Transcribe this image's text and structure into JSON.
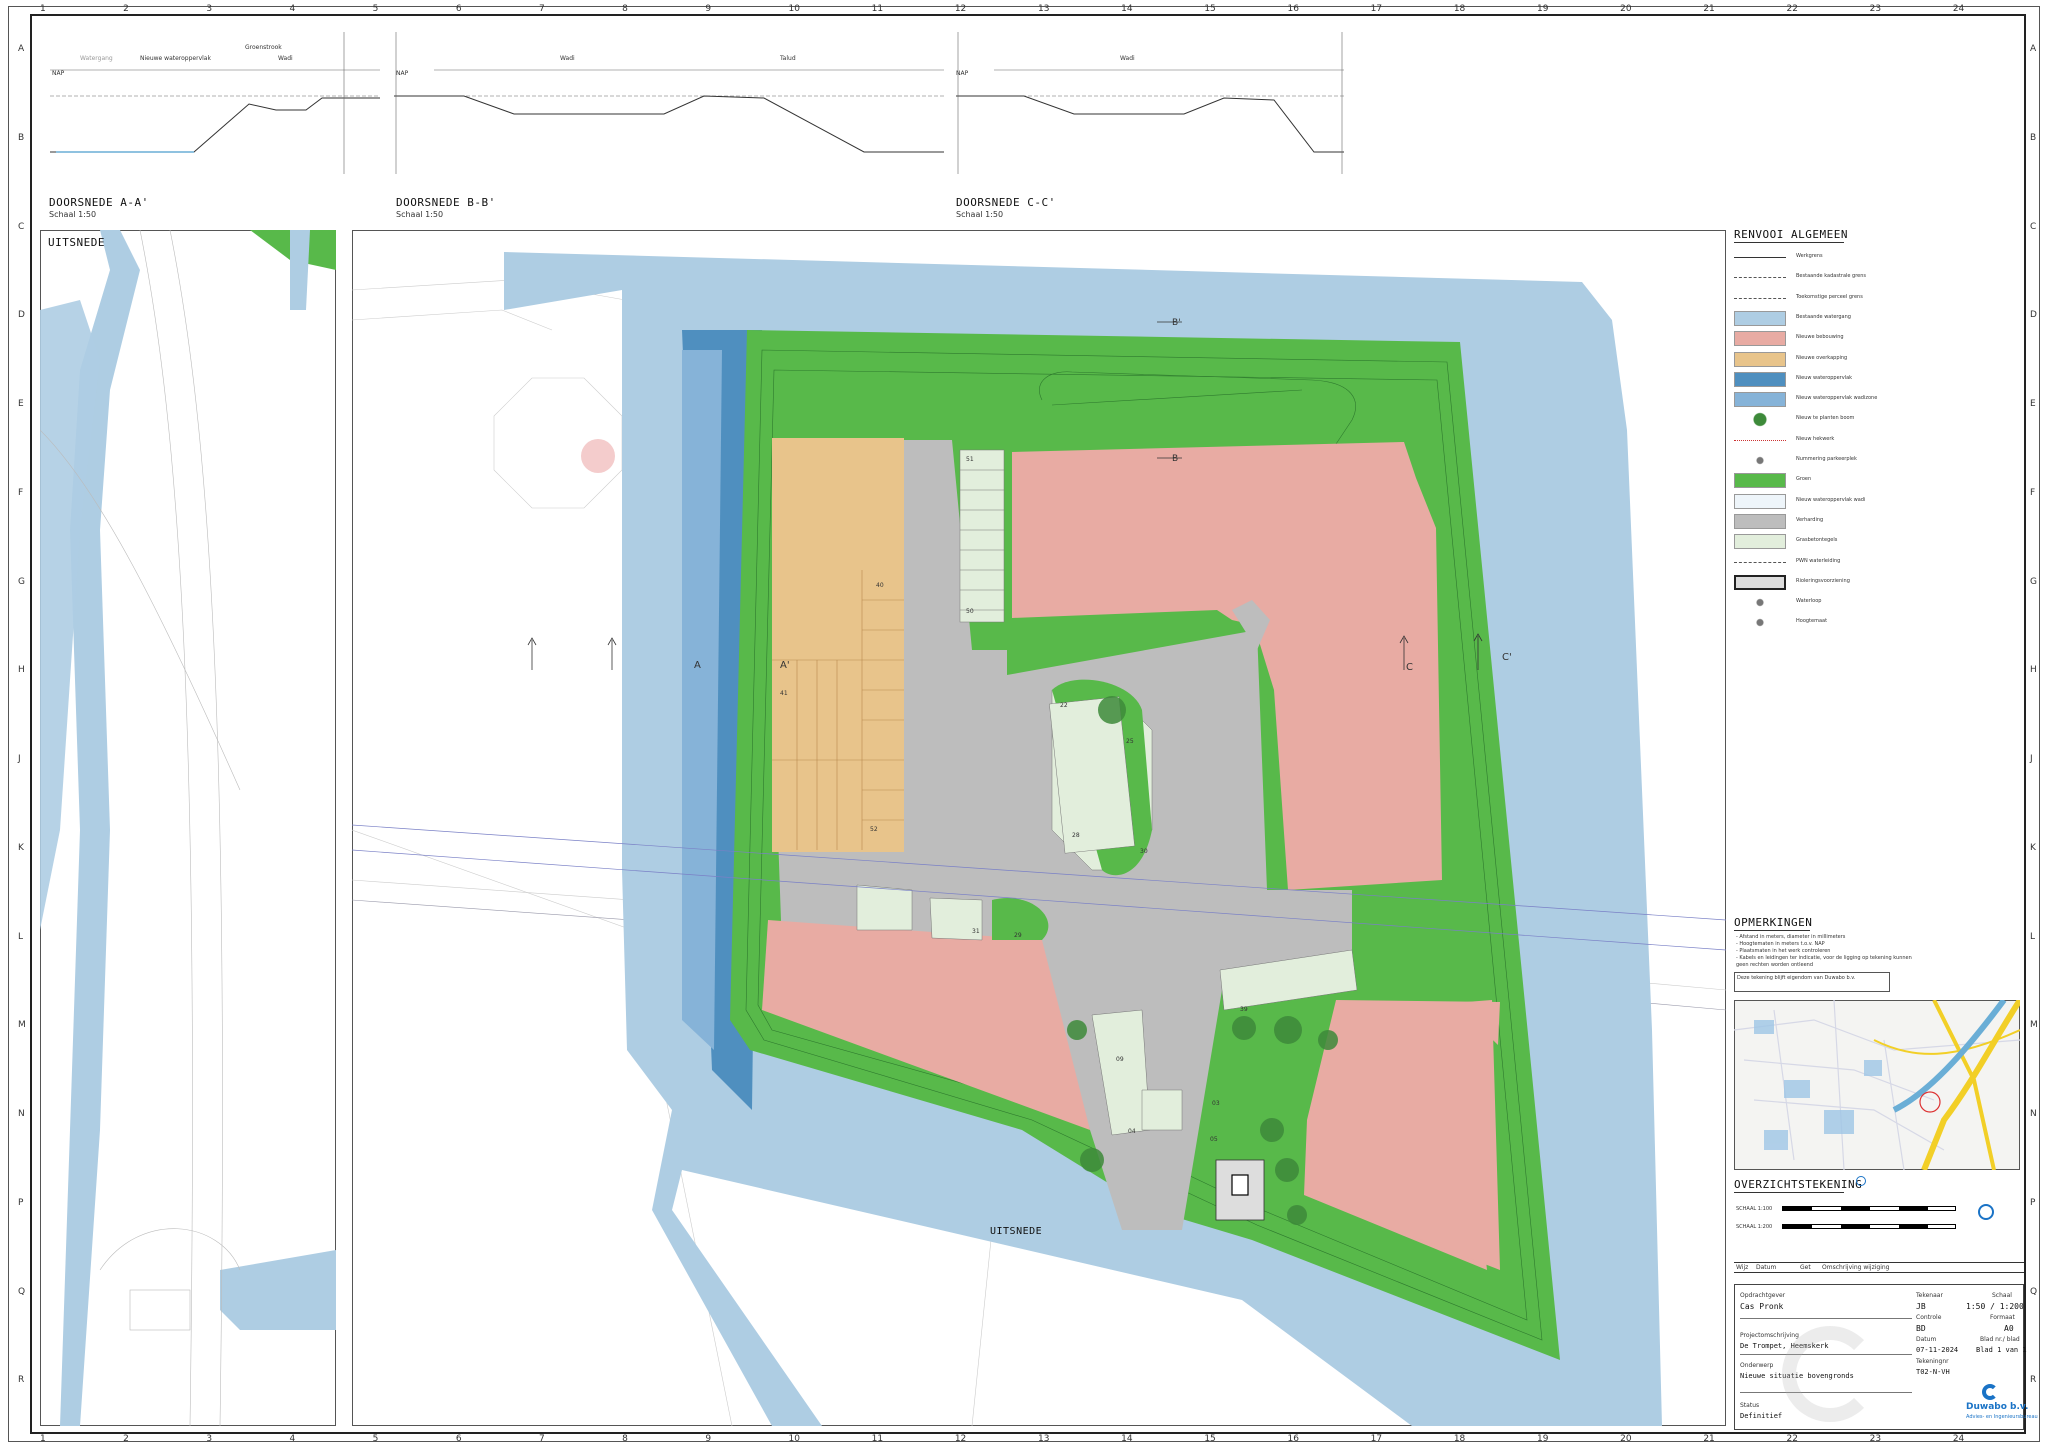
{
  "sections": {
    "a": {
      "title": "DOORSNEDE A-A'",
      "scale": "Schaal 1:50"
    },
    "b": {
      "title": "DOORSNEDE B-B'",
      "scale": "Schaal 1:50"
    },
    "c": {
      "title": "DOORSNEDE C-C'",
      "scale": "Schaal 1:50"
    }
  },
  "section_text": {
    "nap": "NAP",
    "watergang": "Watergang",
    "nieuwe_wateropp": "Nieuwe wateroppervlak",
    "talud": "Talud",
    "groenstrook": "Groenstrook",
    "wadi": "Wadi"
  },
  "uitsnede": "UITSNEDE",
  "plan_labels": {
    "a": "A",
    "a_prime": "A'",
    "b_top": "B'",
    "b_mid": "B",
    "c": "C",
    "c_prime": "C'",
    "uitsnede_bottom": "UITSNEDE"
  },
  "parking_numbers": [
    "51",
    "50",
    "40",
    "41",
    "52",
    "22",
    "25",
    "28",
    "30",
    "31",
    "29",
    "39",
    "09",
    "04",
    "03",
    "05"
  ],
  "legend": {
    "title": "RENVOOI ALGEMEEN",
    "items": [
      {
        "label": "Werkgrens",
        "kind": "line"
      },
      {
        "label": "Bestaande kadastrale grens",
        "kind": "dash"
      },
      {
        "label": "Toekomstige perceel grens",
        "kind": "dash"
      },
      {
        "label": "Bestaande watergang",
        "kind": "fill",
        "color": "#aecde3"
      },
      {
        "label": "Nieuwe bebouwing",
        "kind": "fill",
        "color": "#e8aba3"
      },
      {
        "label": "Nieuwe overkapping",
        "kind": "fill",
        "color": "#e8c48b"
      },
      {
        "label": "Nieuw wateroppervlak",
        "kind": "fill",
        "color": "#4f8fbf"
      },
      {
        "label": "Nieuw wateroppervlak wadizone",
        "kind": "fill",
        "color": "#86b3d8"
      },
      {
        "label": "Nieuw te planten boom",
        "kind": "tree"
      },
      {
        "label": "Nieuw hekwerk",
        "kind": "fence"
      },
      {
        "label": "Nummering parkeerplek",
        "kind": "num"
      },
      {
        "label": "Groen",
        "kind": "fill",
        "color": "#58b94a"
      },
      {
        "label": "Nieuw wateroppervlak wadi",
        "kind": "fill",
        "color": "#eef5fa"
      },
      {
        "label": "Verharding",
        "kind": "fill",
        "color": "#bdbdbd"
      },
      {
        "label": "Grasbetontegels",
        "kind": "fill",
        "color": "#e2eedc"
      },
      {
        "label": "PWN waterleiding",
        "kind": "dash"
      },
      {
        "label": "Rioleringsvoorziening",
        "kind": "box"
      },
      {
        "label": "Waterloop",
        "kind": "tri"
      },
      {
        "label": "Hoogtemaat",
        "kind": "dot"
      }
    ]
  },
  "remarks": {
    "title": "OPMERKINGEN",
    "lines": [
      "- Afstand in meters, diameter in millimeters",
      "- Hoogtematen in meters t.o.v. NAP",
      "- Plaatsmaten in het werk controleren",
      "- Kabels en leidingen ter indicatie, voor de ligging op tekening kunnen",
      "  geen rechten worden ontleend"
    ],
    "ownership": "Deze tekening blijft eigendom van Duwabo b.v."
  },
  "overview": {
    "title": "OVERZICHTSTEKENING",
    "scale1": "SCHAAL 1:100",
    "scale2": "SCHAAL 1:200"
  },
  "revision_header": {
    "wijz": "Wijz",
    "datum": "Datum",
    "get": "Get",
    "omschrijving": "Omschrijving wijziging"
  },
  "title_block": {
    "opdrachtgever_label": "Opdrachtgever",
    "opdrachtgever": "Cas Pronk",
    "tekenaar_label": "Tekenaar",
    "tekenaar": "JB",
    "schaal_label": "Schaal",
    "schaal": "1:50 / 1:200",
    "controle_label": "Controle",
    "controle": "BD",
    "formaat_label": "Formaat",
    "formaat": "A0",
    "project_label": "Projectomschrijving",
    "project": "De Trompet, Heemskerk",
    "datum_label": "Datum",
    "datum": "07-11-2024",
    "blad_label": "Blad nr./ blad",
    "blad": "Blad 1 van 1",
    "onderwerp_label": "Onderwerp",
    "onderwerp": "Nieuwe situatie bovengronds",
    "tekeningnr_label": "Tekeningnr",
    "tekeningnr": "T02-N-VH",
    "status_label": "Status",
    "status": "Definitief",
    "company": "Duwabo b.v.",
    "company_sub": "Advies- en Ingenieursbureau"
  },
  "ruler_numbers": [
    "1",
    "2",
    "3",
    "4",
    "5",
    "6",
    "7",
    "8",
    "9",
    "10",
    "11",
    "12",
    "13",
    "14",
    "15",
    "16",
    "17",
    "18",
    "19",
    "20",
    "21",
    "22",
    "23",
    "24"
  ],
  "ruler_letters": [
    "A",
    "B",
    "C",
    "D",
    "E",
    "F",
    "G",
    "H",
    "J",
    "K",
    "L",
    "M",
    "N",
    "P",
    "Q",
    "R"
  ]
}
